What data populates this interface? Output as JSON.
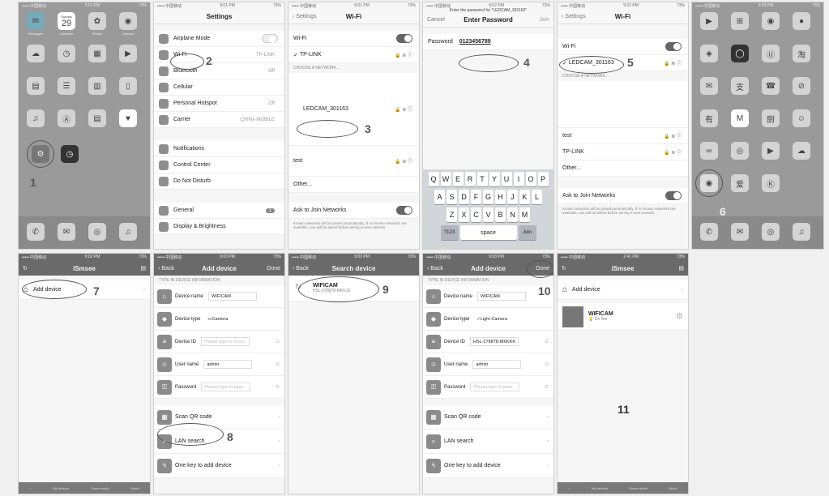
{
  "status": {
    "carrier": "••••• 中国移动",
    "time1": "9:01 PM",
    "time2": "9:02 PM",
    "time3": "9:03 PM",
    "time4": "2:41 PM",
    "battery": "73%"
  },
  "steps": [
    "1",
    "2",
    "3",
    "4",
    "5",
    "6",
    "7",
    "8",
    "9",
    "10",
    "11"
  ],
  "home1": {
    "apps": [
      "Messages",
      "Calendar",
      "Photos",
      "Camera",
      "Weather",
      "Clock",
      "Maps",
      "Videos",
      "Notes",
      "Reminders",
      "Stocks",
      "Game Center",
      "iTunes Store",
      "App Store",
      "Passbook",
      "Health",
      "Settings",
      "Clock"
    ],
    "date": "29",
    "day": "Sunday"
  },
  "settings": {
    "title": "Settings",
    "items": [
      {
        "label": "Airplane Mode",
        "value": ""
      },
      {
        "label": "Wi-Fi",
        "value": "TP-LINK"
      },
      {
        "label": "Bluetooth",
        "value": "Off"
      },
      {
        "label": "Cellular",
        "value": ""
      },
      {
        "label": "Personal Hotspot",
        "value": "Off"
      },
      {
        "label": "Carrier",
        "value": "CHINA MOBILE"
      }
    ],
    "items2": [
      "Notifications",
      "Control Center",
      "Do Not Disturb"
    ],
    "items3": [
      {
        "label": "General",
        "value": "1"
      },
      {
        "label": "Display & Brightness",
        "value": ""
      }
    ]
  },
  "wifi1": {
    "back": "Settings",
    "title": "Wi-Fi",
    "wifi_label": "Wi-Fi",
    "connected": "TP-LINK",
    "choose": "CHOOSE A NETWORK...",
    "network": "LEDCAM_301163",
    "test": "test",
    "other": "Other...",
    "ask": "Ask to Join Networks",
    "note": "Known networks will be joined automatically. If no known networks are available, you will be asked before joining a new network."
  },
  "password": {
    "prompt": "Enter the password for \"LEDCAM_301163\"",
    "cancel": "Cancel",
    "title": "Enter Password",
    "join": "Join",
    "label": "Password",
    "value": "0123456789",
    "rows": [
      [
        "Q",
        "W",
        "E",
        "R",
        "T",
        "Y",
        "U",
        "I",
        "O",
        "P"
      ],
      [
        "A",
        "S",
        "D",
        "F",
        "G",
        "H",
        "J",
        "K",
        "L"
      ],
      [
        "Z",
        "X",
        "C",
        "V",
        "B",
        "N",
        "M"
      ]
    ],
    "k123": "?123",
    "space": "space",
    "go": "Join"
  },
  "wifi2": {
    "back": "Settings",
    "title": "Wi-Fi",
    "wifi_label": "Wi-Fi",
    "connected": "LEDCAM_301163",
    "choose": "CHOOSE A NETWORK...",
    "networks": [
      "test",
      "TP-LINK",
      "Other..."
    ],
    "ask": "Ask to Join Networks",
    "note": "Known networks will be joined automatically. If no known networks are available, you will be asked before joining a new network."
  },
  "home2": {
    "apps": [
      "FaceTime",
      "Calculator",
      "Podcasts",
      "Game Center",
      "Ctrip",
      "Apple Watch",
      "iPhone",
      "淘宝",
      "WeChat",
      "支付宝",
      "Whatsapp",
      "AirDrop",
      "有道",
      "Mail",
      "Kitchen",
      "QQ",
      "UC",
      "Find",
      "Video",
      "Cloud",
      "iSmsee",
      "iQIYI",
      "K"
    ]
  },
  "ismsee": {
    "title": "iSmsee",
    "add": "Add device",
    "tabs": [
      "My devices",
      "Scene mode",
      "About"
    ]
  },
  "adddev": {
    "back": "Back",
    "title": "Add device",
    "done": "Done",
    "section": "TYPE IN DEVICE INFORMATION",
    "fields": [
      {
        "label": "Device name",
        "value": "WIFICAM",
        "ph": false
      },
      {
        "label": "Device type",
        "value": "Camera",
        "ph": false
      },
      {
        "label": "Device ID",
        "value": "Please type in ID no.",
        "ph": true
      },
      {
        "label": "User name",
        "value": "admin",
        "ph": false
      },
      {
        "label": "Password",
        "value": "Please type in pass...",
        "ph": true
      }
    ],
    "qr": "Scan QR code",
    "lan": "LAN search",
    "onekey": "One key to add device"
  },
  "search": {
    "back": "Back",
    "title": "Search device",
    "name": "WIFICAM",
    "id": "HSL-278878-MKKJS"
  },
  "adddev2": {
    "back": "Back",
    "title": "Add device",
    "done": "Done",
    "section": "TYPE IN DEVICE INFORMATION",
    "fields": [
      {
        "label": "Device name",
        "value": "WIFICAM",
        "ph": false
      },
      {
        "label": "Device type",
        "value": "Light Camera",
        "ph": false
      },
      {
        "label": "Device ID",
        "value": "HSL-278878-MKKKK",
        "ph": false
      },
      {
        "label": "User name",
        "value": "admin",
        "ph": false
      },
      {
        "label": "Password",
        "value": "Please type in pass...",
        "ph": true
      }
    ],
    "qr": "Scan QR code",
    "lan": "LAN search",
    "onekey": "One key to add device"
  },
  "final": {
    "title": "iSmsee",
    "add": "Add device",
    "cam": "WIFICAM",
    "status": "On line",
    "tabs": [
      "My devices",
      "Scene mode",
      "About"
    ]
  }
}
